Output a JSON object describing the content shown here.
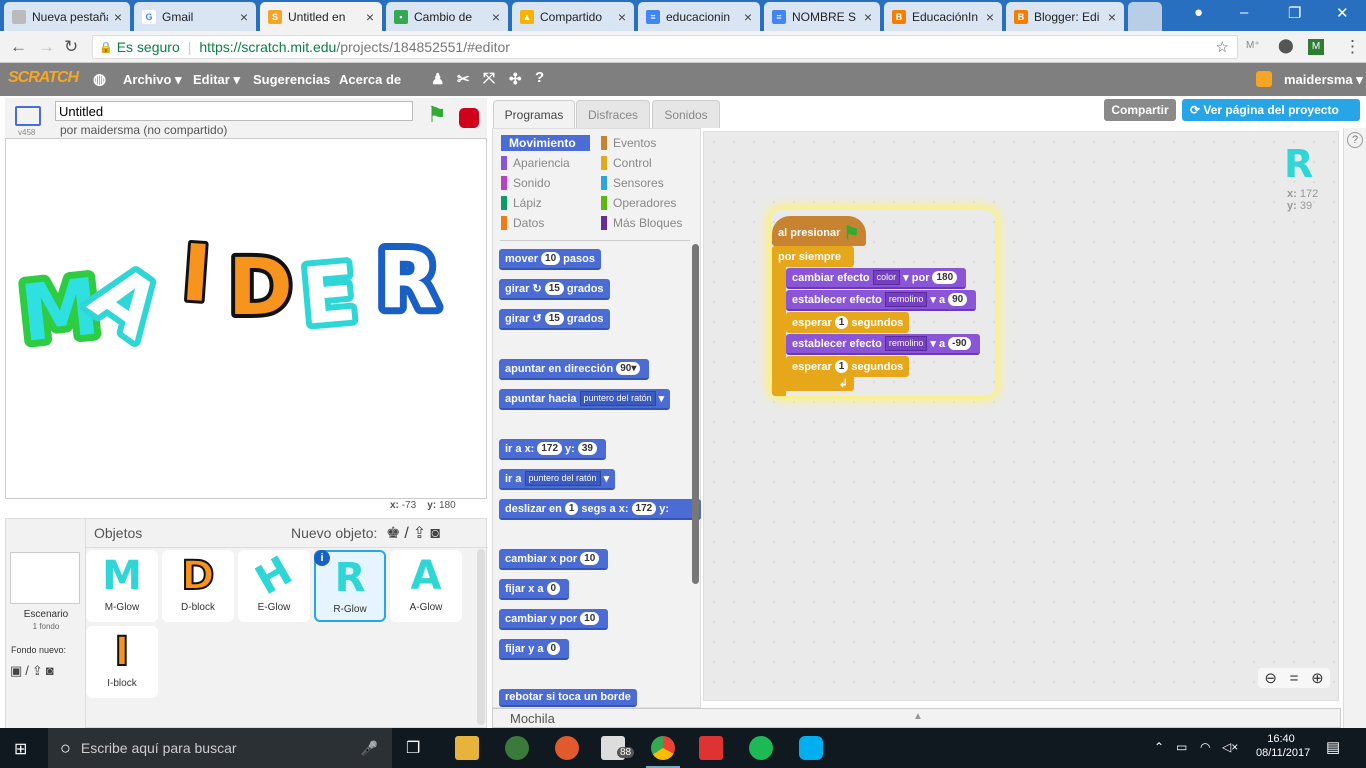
{
  "browser": {
    "tabs": [
      {
        "title": "Nueva pestaña",
        "color": "#9e9e9e"
      },
      {
        "title": "Gmail",
        "color": "#ea4335"
      },
      {
        "title": "Untitled en",
        "color": "#f7a623"
      },
      {
        "title": "Cambio de",
        "color": "#34a853"
      },
      {
        "title": "Compartido",
        "color": "#f4b400"
      },
      {
        "title": "educacionin",
        "color": "#4285f4"
      },
      {
        "title": "NOMBRE S",
        "color": "#4285f4"
      },
      {
        "title": "EducaciónIn",
        "color": "#f57d00"
      },
      {
        "title": "Blogger: Edi",
        "color": "#f57d00"
      }
    ],
    "secure_label": "Es seguro",
    "url_host": "https://scratch.mit.edu",
    "url_path": "/projects/184852551/#editor"
  },
  "menubar": {
    "logo": "SCRATCH",
    "archivo": "Archivo ▾",
    "editar": "Editar ▾",
    "sugerencias": "Sugerencias",
    "acerca": "Acerca de",
    "user": "maidersma ▾"
  },
  "stage": {
    "version": "v458",
    "title_value": "Untitled",
    "author": "por maidersma (no compartido)",
    "letters": [
      "M",
      "A",
      "I",
      "D",
      "E",
      "R"
    ],
    "coords_x_label": "x:",
    "coords_x": "-73",
    "coords_y_label": "y:",
    "coords_y": "180"
  },
  "sprites": {
    "header": "Objetos",
    "new_label": "Nuevo objeto:",
    "stage_label": "Escenario",
    "stage_sub": "1 fondo",
    "new_backdrop": "Fondo nuevo:",
    "items": [
      {
        "name": "M-Glow",
        "glyph": "M",
        "color": "#2fd6d6"
      },
      {
        "name": "D-block",
        "glyph": "D",
        "color": "#f7941d"
      },
      {
        "name": "E-Glow",
        "glyph": "H",
        "color": "#2fd6d6"
      },
      {
        "name": "R-Glow",
        "glyph": "R",
        "color": "#2fd6d6"
      },
      {
        "name": "A-Glow",
        "glyph": "A",
        "color": "#2fd6d6"
      },
      {
        "name": "I-block",
        "glyph": "I",
        "color": "#f7941d"
      }
    ]
  },
  "panel_tabs": {
    "programas": "Programas",
    "disfraces": "Disfraces",
    "sonidos": "Sonidos"
  },
  "header_buttons": {
    "share": "Compartir",
    "view": "Ver página del proyecto"
  },
  "categories": {
    "movimiento": "Movimiento",
    "eventos": "Eventos",
    "apariencia": "Apariencia",
    "control": "Control",
    "sonido": "Sonido",
    "sensores": "Sensores",
    "lapiz": "Lápiz",
    "operadores": "Operadores",
    "datos": "Datos",
    "mas": "Más Bloques"
  },
  "palette": {
    "b1": {
      "a": "mover",
      "n": "10",
      "b": "pasos"
    },
    "b2": {
      "a": "girar",
      "n": "15",
      "b": "grados"
    },
    "b3": {
      "a": "girar",
      "n": "15",
      "b": "grados"
    },
    "b4": {
      "a": "apuntar en dirección",
      "n": "90▾"
    },
    "b5": {
      "a": "apuntar hacia",
      "d": "puntero del ratón"
    },
    "b6": {
      "a": "ir a x:",
      "n": "172",
      "b": "y:",
      "n2": "39"
    },
    "b7": {
      "a": "ir a",
      "d": "puntero del ratón"
    },
    "b8": {
      "a": "deslizar en",
      "n": "1",
      "b": "segs a x:",
      "n2": "172",
      "c": "y:"
    },
    "b9": {
      "a": "cambiar x por",
      "n": "10"
    },
    "b10": {
      "a": "fijar x a",
      "n": "0"
    },
    "b11": {
      "a": "cambiar y por",
      "n": "10"
    },
    "b12": {
      "a": "fijar y a",
      "n": "0"
    },
    "b13": {
      "a": "rebotar si toca un borde"
    }
  },
  "script": {
    "hat": "al presionar",
    "forever": "por siempre",
    "s1": {
      "a": "cambiar efecto",
      "d": "color",
      "b": "por",
      "n": "180"
    },
    "s2": {
      "a": "establecer efecto",
      "d": "remolino",
      "b": "a",
      "n": "90"
    },
    "s3": {
      "a": "esperar",
      "n": "1",
      "b": "segundos"
    },
    "s4": {
      "a": "establecer efecto",
      "d": "remolino",
      "b": "a",
      "n": "-90"
    },
    "s5": {
      "a": "esperar",
      "n": "1",
      "b": "segundos"
    }
  },
  "sprite_info": {
    "glyph": "R",
    "x_label": "x:",
    "x": "172",
    "y_label": "y:",
    "y": "39"
  },
  "mochila": "Mochila",
  "taskbar": {
    "search": "Escribe aquí para buscar",
    "mail_badge": "88",
    "time": "16:40",
    "date": "08/11/2017"
  }
}
